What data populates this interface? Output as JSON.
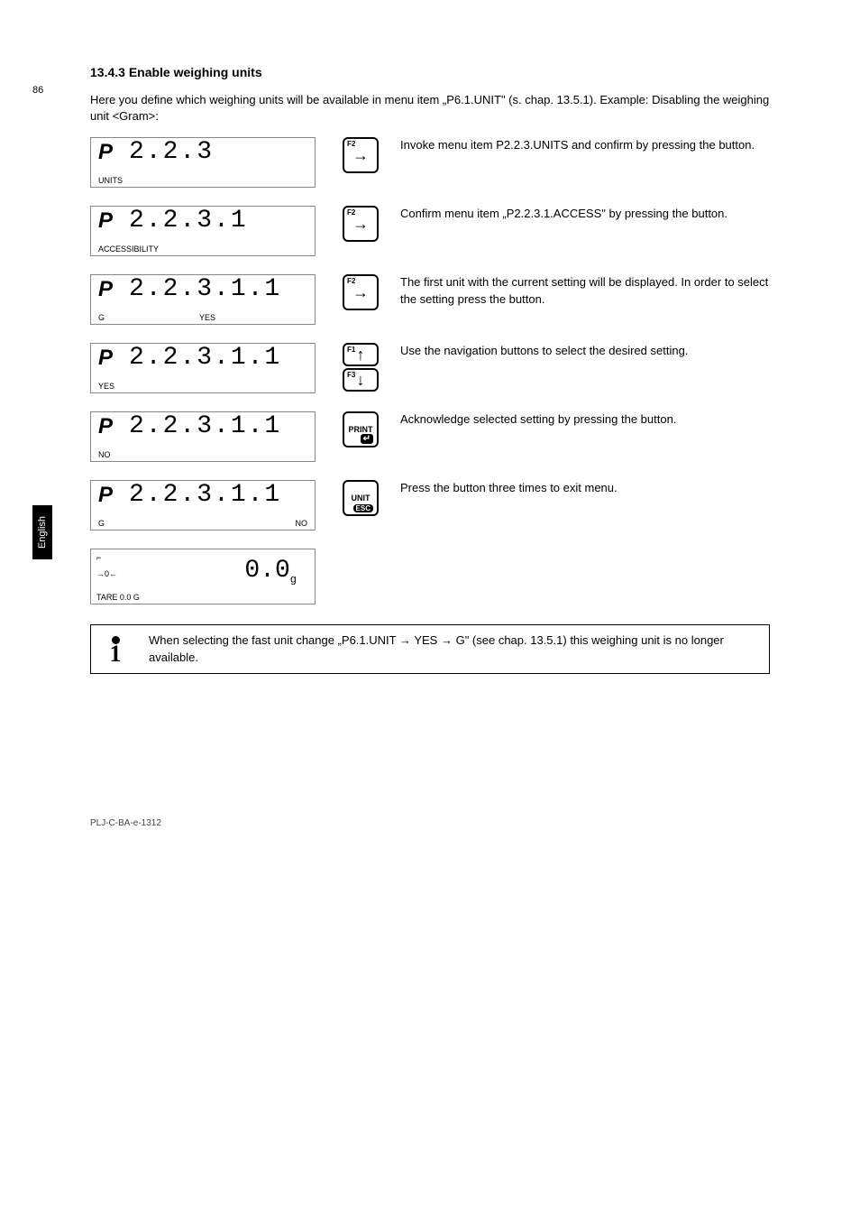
{
  "page_number": "86",
  "side_tab": "English",
  "section_heading": "13.4.3 Enable weighing units",
  "intro": "Here you define which weighing units will be available in menu item „P6.1.UNIT\" (s. chap. 13.5.1). Example: Disabling the weighing unit <Gram>:",
  "steps": [
    {
      "lcd": {
        "p": "P",
        "main": "2.2.3",
        "sub_bl": "UNITS"
      },
      "buttons": [
        {
          "type": "f2right"
        }
      ],
      "desc": "Invoke menu item P2.2.3.UNITS and confirm by pressing the         button."
    },
    {
      "lcd": {
        "p": "P",
        "main": "2.2.3.1",
        "sub_bl": "ACCESSIBILITY"
      },
      "buttons": [
        {
          "type": "f2right"
        }
      ],
      "desc": "Confirm menu item „P2.2.3.1.ACCESS\" by pressing the         button."
    },
    {
      "lcd": {
        "p": "P",
        "main": "2.2.3.1.1",
        "sub_bl": "G",
        "sub_bc": "YES"
      },
      "buttons": [
        {
          "type": "f2right"
        }
      ],
      "desc": "The first unit with the current setting will be displayed. In order to select the setting press the         button."
    },
    {
      "lcd": {
        "p": "P",
        "main": "2.2.3.1.1",
        "sub_bl": "YES"
      },
      "buttons": [
        {
          "type": "f1up"
        },
        {
          "type": "f3down"
        }
      ],
      "desc": "Use the navigation buttons to select the desired setting."
    },
    {
      "lcd": {
        "p": "P",
        "main": "2.2.3.1.1",
        "sub_bl": "NO"
      },
      "buttons": [
        {
          "type": "print"
        }
      ],
      "desc": "Acknowledge selected setting by pressing the         button."
    },
    {
      "lcd": {
        "p": "P",
        "main": "2.2.3.1.1",
        "sub_bl": "G",
        "sub_br": "NO"
      },
      "buttons": [
        {
          "type": "unit"
        }
      ],
      "desc": "Press the         button three times to exit menu."
    },
    {
      "lcd_weight": {
        "stable": "⌐",
        "zero": "→0←",
        "tare": "TARE   0.0   G",
        "value": "0.0",
        "unit": "g"
      },
      "buttons": [],
      "desc": ""
    }
  ],
  "info_note": "When selecting the fast unit change „P6.1.UNIT → YES → G\" (see chap. 13.5.1) this weighing unit is no longer available.",
  "footer": "PLJ-C-BA-e-1312"
}
